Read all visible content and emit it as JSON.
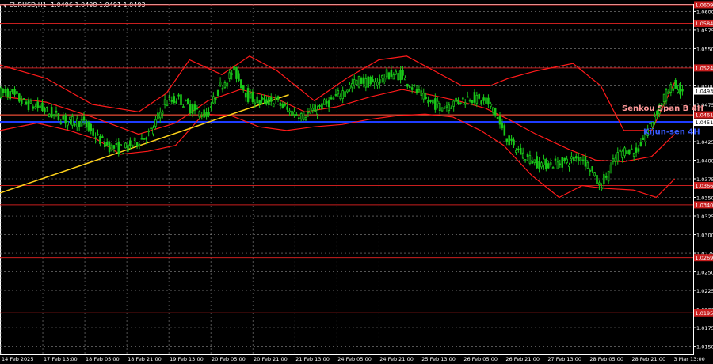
{
  "header": {
    "symbol_tf": "EURUSD,H1",
    "ohlc": "1.0496 1.0498 1.0491 1.0493",
    "triangle_icon": "▼"
  },
  "colors": {
    "background": "#000000",
    "grid": "#8a8a8a",
    "candle_up": "#19c819",
    "candle_down": "#19c819",
    "bollinger": "#ff1a1a",
    "trend": "#ffd21a",
    "level": "#c81e1e",
    "senkou": "#ff5a3c",
    "kijun": "#1e3cff",
    "price_tag": "#ffffff"
  },
  "chart_data": {
    "type": "candlestick",
    "symbol": "EURUSD",
    "timeframe": "H1",
    "ylim": [
      1.014,
      1.061
    ],
    "y_ticks": [
      "1.0600",
      "1.0575",
      "1.0550",
      "1.0525",
      "1.0500",
      "1.0475",
      "1.0450",
      "1.0425",
      "1.0400",
      "1.0375",
      "1.0350",
      "1.0325",
      "1.0300",
      "1.0275",
      "1.0250",
      "1.0225",
      "1.0200",
      "1.0175",
      "1.0150"
    ],
    "x_ticks": [
      "14 Feb 2025",
      "17 Feb 13:00",
      "18 Feb 05:00",
      "18 Feb 21:00",
      "19 Feb 13:00",
      "20 Feb 05:00",
      "20 Feb 21:00",
      "21 Feb 13:00",
      "24 Feb 05:00",
      "24 Feb 21:00",
      "25 Feb 13:00",
      "26 Feb 05:00",
      "26 Feb 21:00",
      "27 Feb 13:00",
      "28 Feb 05:00",
      "28 Feb 21:00",
      "3 Mar 13:00"
    ],
    "current_price": "1.0493",
    "levels": [
      {
        "value": 1.0609,
        "tag": "1.0609"
      },
      {
        "value": 1.0584,
        "tag": "1.0584"
      },
      {
        "value": 1.0524,
        "tag": "1.0524"
      },
      {
        "value": 1.0461,
        "tag": "1.0461"
      },
      {
        "value": 1.0366,
        "tag": "1.0366"
      },
      {
        "value": 1.034,
        "tag": "1.0340"
      },
      {
        "value": 1.0269,
        "tag": "1.0269"
      },
      {
        "value": 1.0195,
        "tag": "1.0195"
      }
    ],
    "senkou_span_b": {
      "value": 1.0461,
      "label": "Senkou Span B 4H"
    },
    "kijun_sen": {
      "value": 1.0451,
      "label": "Kijun-sen 4H",
      "tag": "1.0451"
    },
    "trendline": {
      "from": [
        0,
        1.0356
      ],
      "to": [
        125,
        1.0488
      ]
    },
    "price_path": [
      [
        0,
        1.0492
      ],
      [
        6,
        1.0488
      ],
      [
        12,
        1.0475
      ],
      [
        18,
        1.047
      ],
      [
        24,
        1.046
      ],
      [
        30,
        1.0452
      ],
      [
        36,
        1.0452
      ],
      [
        42,
        1.0432
      ],
      [
        48,
        1.0418
      ],
      [
        54,
        1.0415
      ],
      [
        60,
        1.0425
      ],
      [
        66,
        1.0438
      ],
      [
        72,
        1.0478
      ],
      [
        78,
        1.0482
      ],
      [
        84,
        1.0468
      ],
      [
        90,
        1.046
      ],
      [
        96,
        1.05
      ],
      [
        102,
        1.052
      ],
      [
        108,
        1.0485
      ],
      [
        114,
        1.0478
      ],
      [
        120,
        1.048
      ],
      [
        126,
        1.0465
      ],
      [
        132,
        1.046
      ],
      [
        138,
        1.047
      ],
      [
        144,
        1.048
      ],
      [
        150,
        1.0495
      ],
      [
        156,
        1.0508
      ],
      [
        162,
        1.0502
      ],
      [
        168,
        1.0515
      ],
      [
        174,
        1.0515
      ],
      [
        180,
        1.0495
      ],
      [
        186,
        1.0478
      ],
      [
        192,
        1.0472
      ],
      [
        198,
        1.0478
      ],
      [
        204,
        1.0485
      ],
      [
        210,
        1.0478
      ],
      [
        214,
        1.047
      ],
      [
        218,
        1.044
      ],
      [
        222,
        1.042
      ],
      [
        228,
        1.0405
      ],
      [
        234,
        1.0395
      ],
      [
        240,
        1.0395
      ],
      [
        246,
        1.0398
      ],
      [
        252,
        1.0405
      ],
      [
        256,
        1.039
      ],
      [
        260,
        1.0365
      ],
      [
        264,
        1.0385
      ],
      [
        268,
        1.0408
      ],
      [
        272,
        1.0415
      ],
      [
        276,
        1.041
      ],
      [
        280,
        1.0435
      ],
      [
        284,
        1.046
      ],
      [
        288,
        1.0485
      ],
      [
        292,
        1.05
      ],
      [
        295,
        1.0493
      ]
    ],
    "bb_upper": [
      [
        0,
        1.0528
      ],
      [
        20,
        1.051
      ],
      [
        40,
        1.0475
      ],
      [
        60,
        1.0465
      ],
      [
        72,
        1.049
      ],
      [
        82,
        1.0535
      ],
      [
        96,
        1.0515
      ],
      [
        108,
        1.054
      ],
      [
        120,
        1.052
      ],
      [
        136,
        1.048
      ],
      [
        150,
        1.051
      ],
      [
        164,
        1.0535
      ],
      [
        176,
        1.054
      ],
      [
        188,
        1.052
      ],
      [
        200,
        1.05
      ],
      [
        212,
        1.05
      ],
      [
        220,
        1.051
      ],
      [
        232,
        1.052
      ],
      [
        248,
        1.053
      ],
      [
        260,
        1.05
      ],
      [
        270,
        1.044
      ],
      [
        282,
        1.044
      ],
      [
        292,
        1.0505
      ]
    ],
    "bb_lower": [
      [
        0,
        1.044
      ],
      [
        16,
        1.045
      ],
      [
        30,
        1.044
      ],
      [
        42,
        1.0428
      ],
      [
        52,
        1.0408
      ],
      [
        64,
        1.0412
      ],
      [
        76,
        1.042
      ],
      [
        88,
        1.0462
      ],
      [
        100,
        1.046
      ],
      [
        112,
        1.0445
      ],
      [
        124,
        1.044
      ],
      [
        136,
        1.0445
      ],
      [
        148,
        1.0448
      ],
      [
        160,
        1.0455
      ],
      [
        172,
        1.046
      ],
      [
        184,
        1.0462
      ],
      [
        196,
        1.0458
      ],
      [
        208,
        1.044
      ],
      [
        218,
        1.042
      ],
      [
        230,
        1.038
      ],
      [
        242,
        1.035
      ],
      [
        252,
        1.0366
      ],
      [
        262,
        1.0362
      ],
      [
        274,
        1.036
      ],
      [
        284,
        1.035
      ],
      [
        292,
        1.0375
      ]
    ],
    "bb_middle": [
      [
        0,
        1.0486
      ],
      [
        20,
        1.0478
      ],
      [
        40,
        1.0458
      ],
      [
        60,
        1.0435
      ],
      [
        76,
        1.045
      ],
      [
        90,
        1.048
      ],
      [
        104,
        1.0495
      ],
      [
        118,
        1.0485
      ],
      [
        132,
        1.0465
      ],
      [
        146,
        1.0472
      ],
      [
        160,
        1.0485
      ],
      [
        174,
        1.0495
      ],
      [
        186,
        1.0488
      ],
      [
        198,
        1.048
      ],
      [
        210,
        1.047
      ],
      [
        220,
        1.0455
      ],
      [
        232,
        1.0435
      ],
      [
        246,
        1.0415
      ],
      [
        258,
        1.04
      ],
      [
        270,
        1.0398
      ],
      [
        282,
        1.0405
      ],
      [
        292,
        1.0435
      ]
    ]
  }
}
